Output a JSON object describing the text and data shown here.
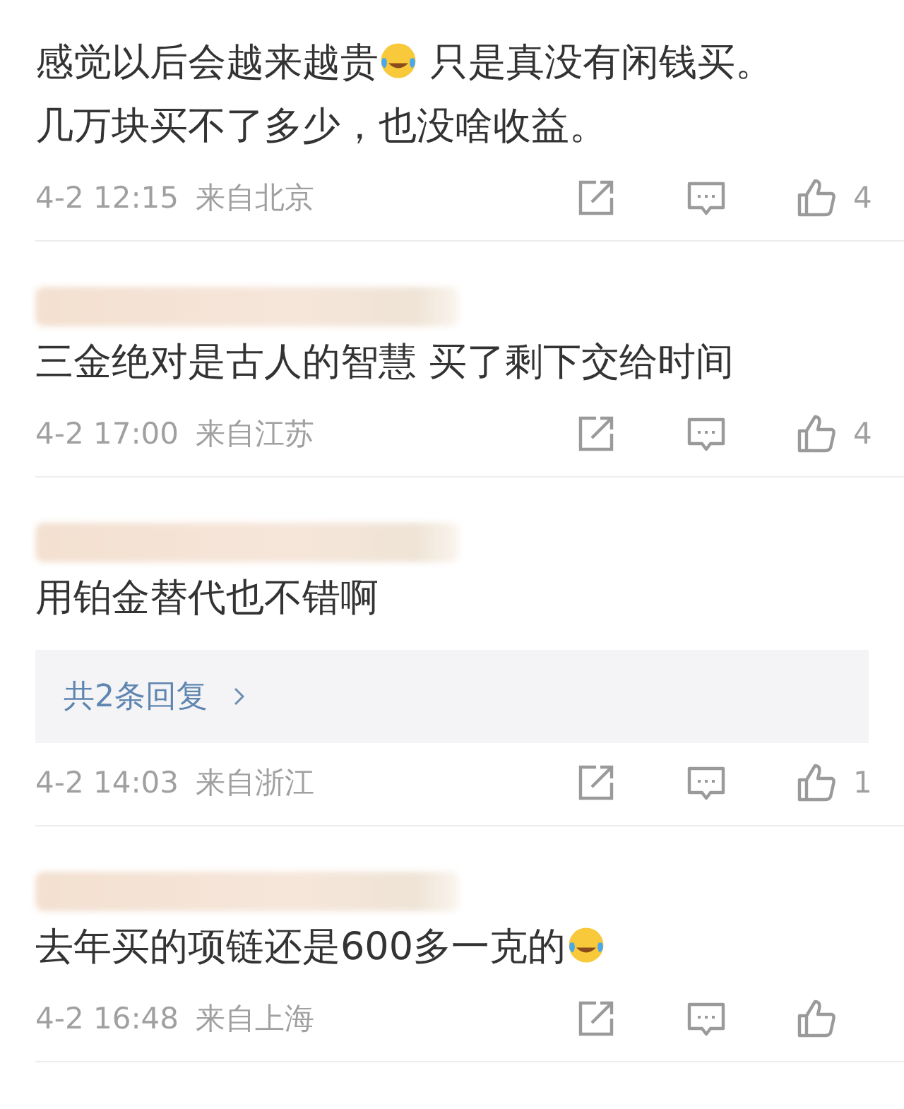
{
  "comments": [
    {
      "author_blurred": false,
      "segments": [
        {
          "kind": "text",
          "text": "感觉以后会越来越贵"
        },
        {
          "kind": "emoji"
        },
        {
          "kind": "text",
          "text": " 只是真没有闲钱买。几万块买不了多少，也没啥收益。"
        }
      ],
      "time": "4-2 12:15",
      "source": "来自北京",
      "likes": "4"
    },
    {
      "author_blurred": true,
      "segments": [
        {
          "kind": "text",
          "text": "三金绝对是古人的智慧 买了剩下交给时间"
        }
      ],
      "time": "4-2 17:00",
      "source": "来自江苏",
      "likes": "4"
    },
    {
      "author_blurred": true,
      "segments": [
        {
          "kind": "text",
          "text": "用铂金替代也不错啊"
        }
      ],
      "replies": "共2条回复",
      "time": "4-2 14:03",
      "source": "来自浙江",
      "likes": "1"
    },
    {
      "author_blurred": true,
      "segments": [
        {
          "kind": "text",
          "text": "去年买的项链还是600多一克的"
        },
        {
          "kind": "emoji"
        }
      ],
      "time": "4-2 16:48",
      "source": "来自上海"
    }
  ]
}
